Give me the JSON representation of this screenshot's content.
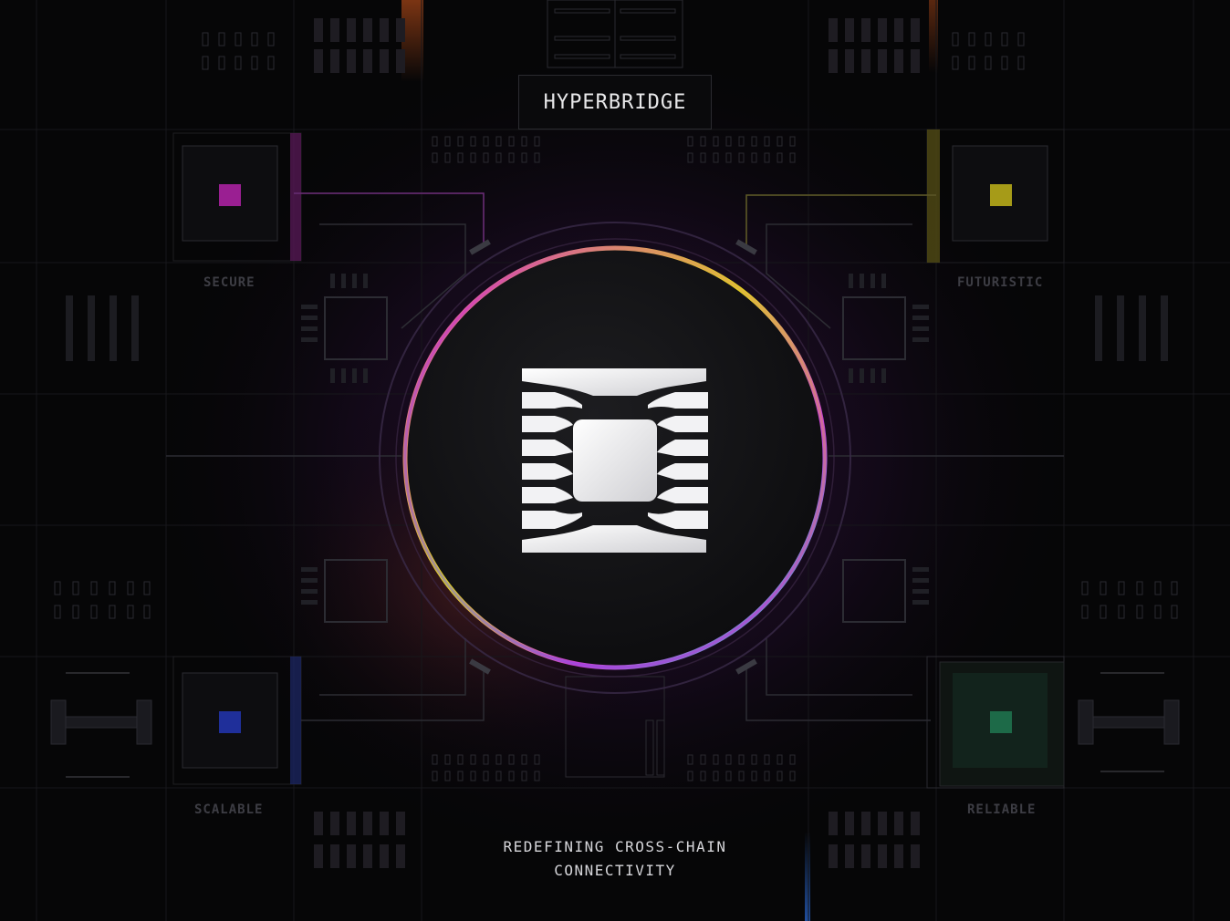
{
  "brand": {
    "title": "HYPERBRIDGE",
    "logo_icon": "hyperbridge-chip-icon"
  },
  "quadrants": {
    "top_left": "SECURE",
    "top_right": "FUTURISTIC",
    "bottom_left": "SCALABLE",
    "bottom_right": "RELIABLE"
  },
  "tagline": {
    "line1": "REDEFINING CROSS-CHAIN",
    "line2": "CONNECTIVITY"
  },
  "colors": {
    "background": "#060607",
    "accent_magenta": "#d22ccf",
    "accent_yellow": "#e3d51e",
    "accent_cyan": "#36c6cf",
    "accent_purple": "#8a4ce0",
    "accent_blue": "#1f2f9a",
    "accent_green": "#1d6a48",
    "accent_orange": "#c0501a"
  }
}
